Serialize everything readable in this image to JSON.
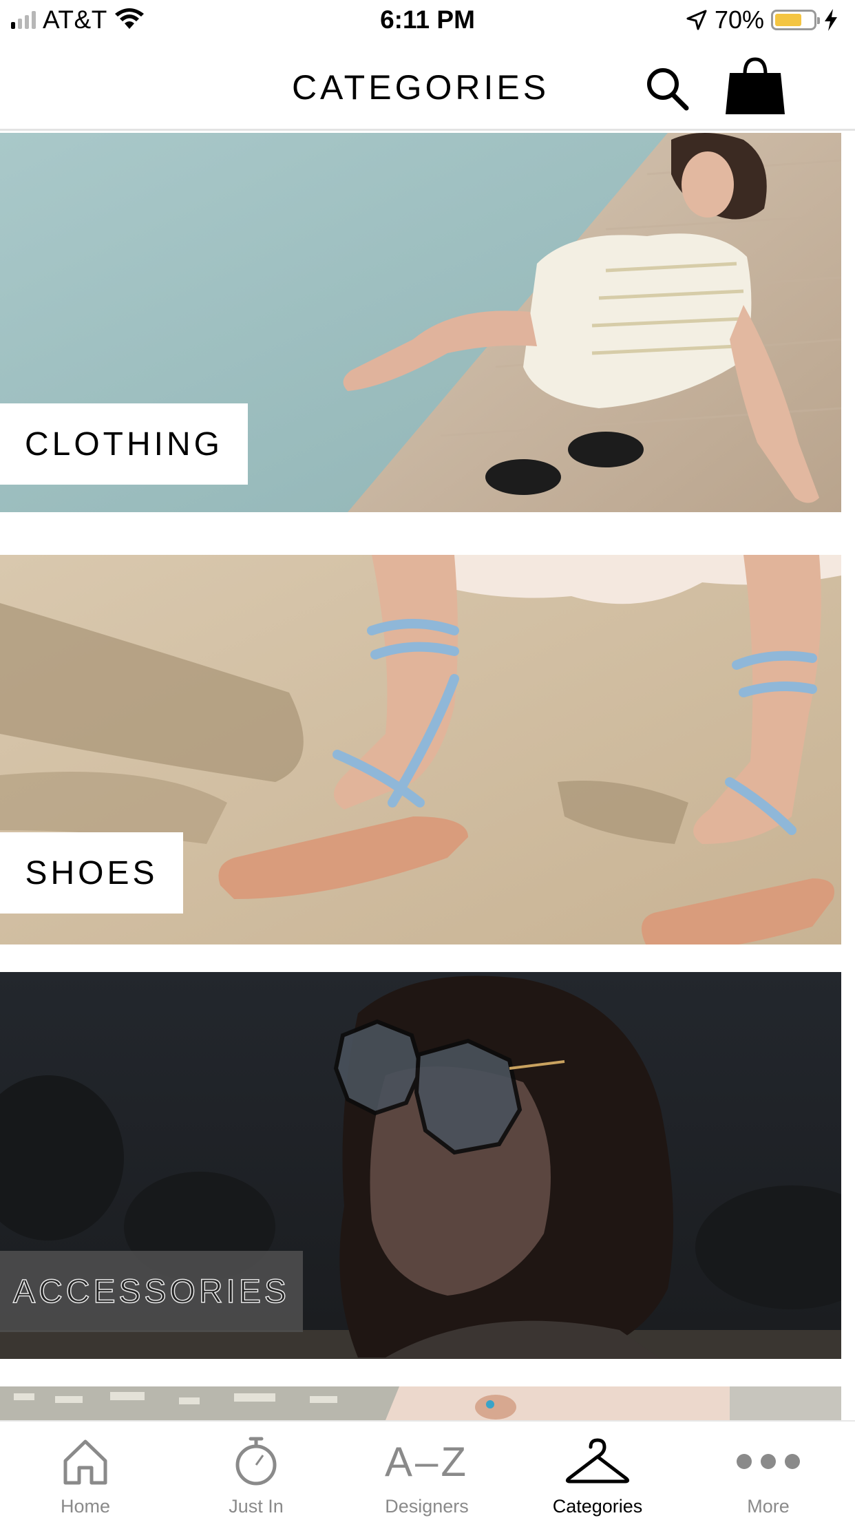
{
  "status_bar": {
    "carrier": "AT&T",
    "time": "6:11 PM",
    "battery_percent": "70%",
    "battery_level": 0.7
  },
  "header": {
    "title": "CATEGORIES",
    "search_icon": "search-icon",
    "bag_icon": "shopping-bag-icon"
  },
  "categories": [
    {
      "label": "CLOTHING"
    },
    {
      "label": "SHOES"
    },
    {
      "label": "ACCESSORIES"
    }
  ],
  "tab_bar": {
    "tabs": [
      {
        "label": "Home",
        "icon": "home-icon"
      },
      {
        "label": "Just In",
        "icon": "stopwatch-icon"
      },
      {
        "label": "Designers",
        "icon": "a-z-icon",
        "icon_text": "A–Z"
      },
      {
        "label": "Categories",
        "icon": "hanger-icon",
        "active": true
      },
      {
        "label": "More",
        "icon": "more-dots-icon"
      }
    ]
  },
  "colors": {
    "active_tab": "#000000",
    "inactive_tab": "#8a8a8a",
    "battery_fill": "#f4c542"
  }
}
